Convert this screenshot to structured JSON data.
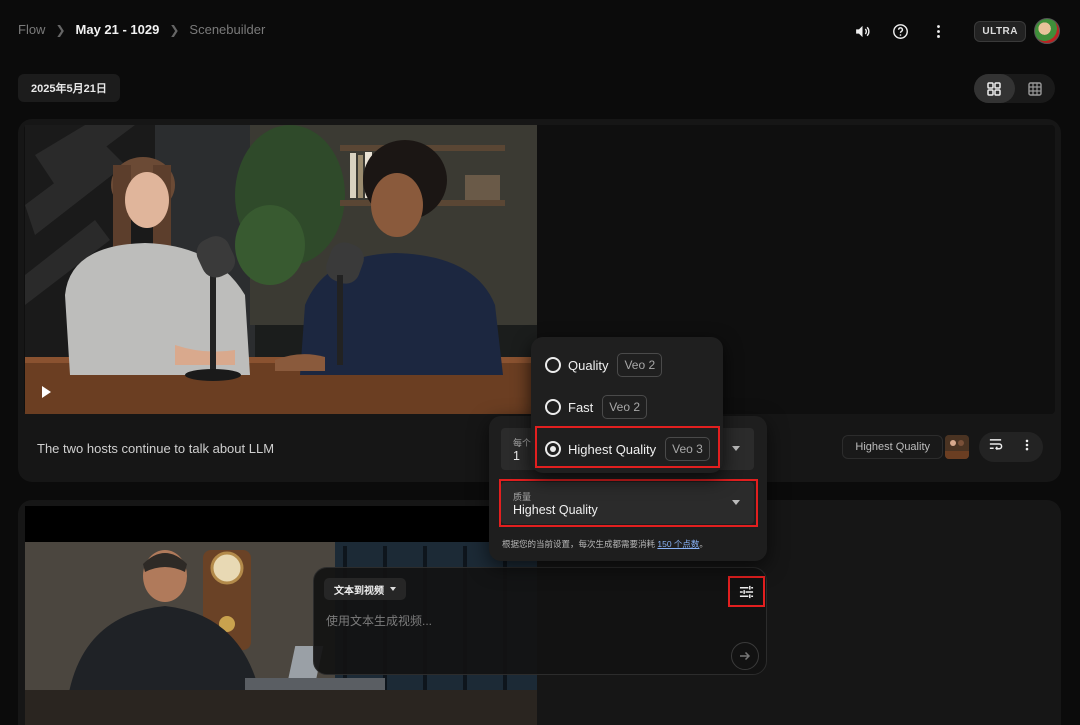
{
  "breadcrumb": {
    "root": "Flow",
    "project": "May 21 - 1029",
    "page": "Scenebuilder"
  },
  "header": {
    "plan_badge": "ULTRA",
    "icons": [
      "volume-icon",
      "help-icon",
      "more-vert-icon"
    ]
  },
  "date_label": "2025年5月21日",
  "view_toggle": {
    "options": [
      "grid-view-icon",
      "large-grid-icon"
    ],
    "selected": "grid-view-icon"
  },
  "clips": [
    {
      "caption": "The two hosts continue to talk about LLM",
      "quality": "Highest Quality"
    },
    {
      "caption": ""
    }
  ],
  "prompt": {
    "mode": "文本到视频",
    "placeholder": "使用文本生成视频..."
  },
  "settings": {
    "count_label": "每个提示的输出数",
    "count_label_visible": "每个提",
    "count_value": "1",
    "quality_label": "质量",
    "quality_value": "Highest Quality",
    "note_text": "根据您的当前设置，每次生成都需要消耗 ",
    "note_link": "150 个点数",
    "note_end": "。"
  },
  "quality_options": [
    {
      "label": "Quality",
      "model": "Veo 2",
      "selected": false
    },
    {
      "label": "Fast",
      "model": "Veo 2",
      "selected": false
    },
    {
      "label": "Highest Quality",
      "model": "Veo 3",
      "selected": true
    }
  ],
  "colors": {
    "highlight": "#e21f1f",
    "link": "#8ab4f8",
    "background": "#0b0b0b"
  }
}
